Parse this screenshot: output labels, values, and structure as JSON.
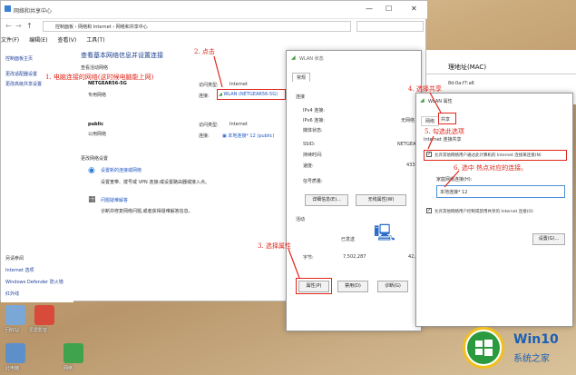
{
  "window": {
    "title": "网络和共享中心",
    "address": "控制面板  ›  网络和 Internet  ›  网络和共享中心",
    "menu": [
      "文件(F)",
      "编辑(E)",
      "查看(V)",
      "工具(T)"
    ],
    "controls": [
      "—",
      "☐",
      "✕"
    ]
  },
  "sidebar": {
    "home": "控制面板主页",
    "links": [
      "更改适配器设置",
      "更改高级共享设置"
    ],
    "see_also_title": "另请参阅",
    "see_also": [
      "Internet 选项",
      "Windows Defender 防火墙",
      "红外线"
    ]
  },
  "main": {
    "heading": "查看基本网络信息并设置连接",
    "active_networks": "查看活动网络",
    "net1": {
      "name": "NETGEAR56-5G",
      "type": "专用网络",
      "access_label": "访问类型:",
      "access_value": "Internet",
      "conn_label": "连接:",
      "conn_value": "WLAN (NETGEAR56-5G)"
    },
    "net2": {
      "name": "public",
      "type": "公用网络",
      "access_label": "访问类型:",
      "access_value": "Internet",
      "conn_label": "连接:",
      "conn_value": "本地连接* 12 (public)"
    },
    "change_settings": "更改网络设置",
    "task1_title": "设置新的连接或网络",
    "task1_desc": "设置宽带、拨号或 VPN 连接;或设置路由器或接入点。",
    "task2_title": "问题疑难解答",
    "task2_desc": "诊断并修复网络问题,或者获得疑难解答信息。"
  },
  "status_dialog": {
    "title": "WLAN 状态",
    "tab": "常规",
    "section_conn": "连接",
    "rows": [
      {
        "label": "IPv4 连接:",
        "value": ""
      },
      {
        "label": "IPv6 连接:",
        "value": "无网络"
      },
      {
        "label": "媒体状态:",
        "value": ""
      },
      {
        "label": "SSID:",
        "value": "NETGEA"
      },
      {
        "label": "持续时间:",
        "value": ""
      },
      {
        "label": "速度:",
        "value": "433"
      }
    ],
    "signal": "信号质量:",
    "btn_details": "详细信息(E)...",
    "btn_wireless": "无线属性(W)",
    "section_activity": "活动",
    "sent": "已发送",
    "bytes_label": "字节:",
    "bytes_sent": "7,502,287",
    "bytes_recv": "42,",
    "btn_props": "属性(P)",
    "btn_disable": "禁用(D)",
    "btn_diagnose": "诊断(G)"
  },
  "mac_panel": {
    "label": "理地址(MAC)",
    "value": "8d:0a:f7:a6"
  },
  "props_dialog": {
    "title": "WLAN 属性",
    "tabs": [
      "网络",
      "共享"
    ],
    "group": "Internet 连接共享",
    "check1": "允许其他网络用户通过此计算机的 Internet 连接来连接(N)",
    "home_label": "家庭网络连接(H):",
    "home_value": "本地连接* 12",
    "check2": "允许其他网络用户控制或禁用共享的 Internet 连接(O)",
    "btn_settings": "设置(G)..."
  },
  "annotations": {
    "a1": "1. 电脑连接的网络(这时候电脑能上网)",
    "a2": "2. 点击",
    "a3": "3. 选择属性",
    "a4": "4. 选择共享",
    "a5": "5. 勾选此选项",
    "a6": "6. 选中 热点对应的连接。"
  },
  "desktop": [
    "回收站",
    "迅雷影音",
    "此电脑",
    "网络"
  ],
  "logo": {
    "title": "Win10",
    "subtitle": "系统之家"
  },
  "colors": {
    "annotation": "#e0261b",
    "link": "#1f57c3",
    "logo_blue": "#1b5fb4"
  }
}
